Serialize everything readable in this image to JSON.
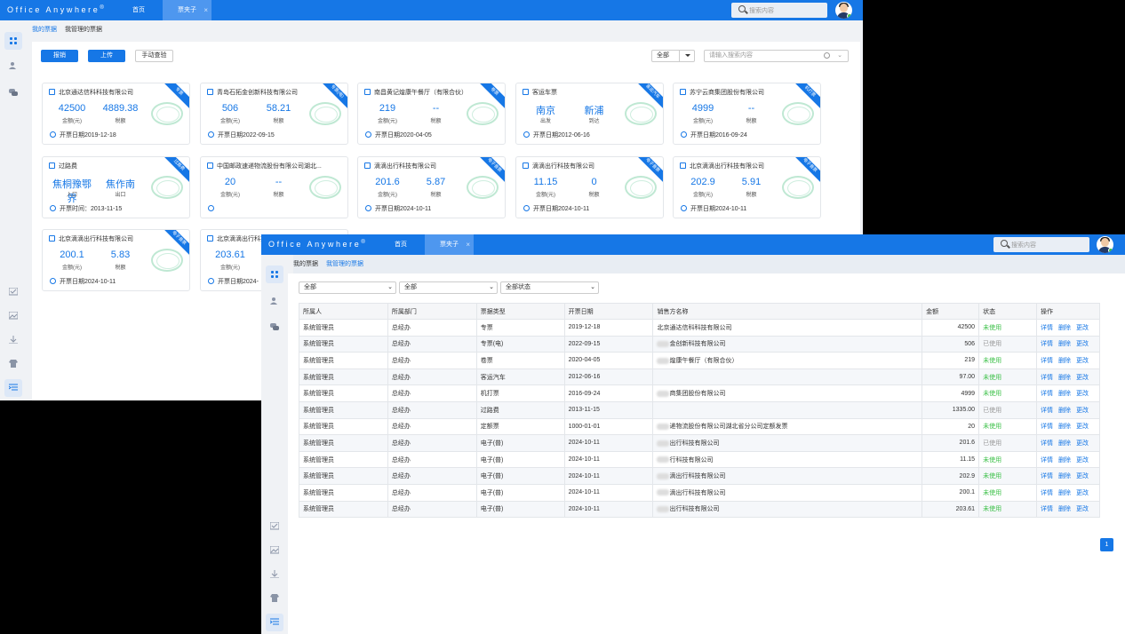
{
  "app": {
    "logo": "Office Anywhere",
    "reg": "®",
    "home_tab": "首页",
    "active_tab": "票夹子",
    "tab_close": "×",
    "search_placeholder": "搜索内容"
  },
  "w1": {
    "subnav": [
      "我的票据",
      "我管理的票据"
    ],
    "buttons": {
      "reimburse": "报销",
      "upload": "上传",
      "manual": "手动查验"
    },
    "filter": "全部",
    "search_placeholder": "请输入搜索内容",
    "cards": [
      {
        "name": "北京通达信科科技有限公司",
        "tag": "专票",
        "v1": "42500",
        "l1": "金额(元)",
        "v2": "4889.38",
        "l2": "税额",
        "date": "开票日期2019-12-18"
      },
      {
        "name": "青岛石拓金创新科技有限公司",
        "tag": "专票(电)",
        "v1": "506",
        "l1": "金额(元)",
        "v2": "58.21",
        "l2": "税额",
        "date": "开票日期2022-09-15"
      },
      {
        "name": "南昌黄记煌康午餐厅（有限合伙）",
        "tag": "卷票",
        "v1": "219",
        "l1": "金额(元)",
        "v2": "--",
        "l2": "税额",
        "date": "开票日期2020-04-05"
      },
      {
        "name": "客运车票",
        "tag": "客运汽车",
        "v1": "南京",
        "l1": "出发",
        "v2": "新浦",
        "l2": "到达",
        "date": "开票日期2012-06-16"
      },
      {
        "name": "苏宁云商集团股份有限公司",
        "tag": "机打票",
        "v1": "4999",
        "l1": "金额(元)",
        "v2": "--",
        "l2": "税额",
        "date": "开票日期2016-09-24"
      },
      {
        "name": "过路费",
        "tag": "过路费",
        "v1": "焦桐豫鄂界",
        "l1": "入口",
        "v2": "焦作南",
        "l2": "出口",
        "date": "开票时间：2013-11-15"
      },
      {
        "name": "中国邮政速递物流股份有限公司湖北...",
        "tag": "",
        "v1": "20",
        "l1": "金额(元)",
        "v2": "--",
        "l2": "税额",
        "date": ""
      },
      {
        "name": "滴滴出行科技有限公司",
        "tag": "电子普票",
        "v1": "201.6",
        "l1": "金额(元)",
        "v2": "5.87",
        "l2": "税额",
        "date": "开票日期2024-10-11"
      },
      {
        "name": "滴滴出行科技有限公司",
        "tag": "电子普票",
        "v1": "11.15",
        "l1": "金额(元)",
        "v2": "0",
        "l2": "税额",
        "date": "开票日期2024-10-11"
      },
      {
        "name": "北京滴滴出行科技有限公司",
        "tag": "电子普票",
        "v1": "202.9",
        "l1": "金额(元)",
        "v2": "5.91",
        "l2": "税额",
        "date": "开票日期2024-10-11"
      },
      {
        "name": "北京滴滴出行科技有限公司",
        "tag": "电子普票",
        "v1": "200.1",
        "l1": "金额(元)",
        "v2": "5.83",
        "l2": "税额",
        "date": "开票日期2024-10-11"
      },
      {
        "name": "北京滴滴出行科技有限公司",
        "tag": "",
        "v1": "203.61",
        "l1": "金额(元)",
        "v2": "",
        "l2": "",
        "date": "开票日期2024-"
      }
    ]
  },
  "w2": {
    "subnav": [
      "我的票据",
      "我管理的票据"
    ],
    "filters": [
      "全部",
      "全部",
      "全部状态"
    ],
    "table": {
      "headers": [
        "所属人",
        "所属部门",
        "票据类型",
        "开票日期",
        "销售方名称",
        "金额",
        "状态",
        "操作"
      ],
      "ops": [
        "详情",
        "删除",
        "更改"
      ],
      "rows": [
        [
          "系统管理员",
          "总经办",
          "专票",
          "2019-12-18",
          "北京通达信科科技有限公司",
          "42500",
          "未使用"
        ],
        [
          "系统管理员",
          "总经办",
          "专票(电)",
          "2022-09-15",
          "金创新科技有限公司",
          "506",
          "已使用"
        ],
        [
          "系统管理员",
          "总经办",
          "卷票",
          "2020-04-05",
          "煌康午餐厅（有限合伙）",
          "219",
          "未使用"
        ],
        [
          "系统管理员",
          "总经办",
          "客运汽车",
          "2012-06-16",
          "",
          "97.00",
          "未使用"
        ],
        [
          "系统管理员",
          "总经办",
          "机打票",
          "2016-09-24",
          "商集团股份有限公司",
          "4999",
          "未使用"
        ],
        [
          "系统管理员",
          "总经办",
          "过路费",
          "2013-11-15",
          "",
          "1335.00",
          "已使用"
        ],
        [
          "系统管理员",
          "总经办",
          "定额票",
          "1000-01-01",
          "递物流股份有限公司湖北省分公司定额发票",
          "20",
          "未使用"
        ],
        [
          "系统管理员",
          "总经办",
          "电子(普)",
          "2024-10-11",
          "出行科技有限公司",
          "201.6",
          "已使用"
        ],
        [
          "系统管理员",
          "总经办",
          "电子(普)",
          "2024-10-11",
          "行科技有限公司",
          "11.15",
          "未使用"
        ],
        [
          "系统管理员",
          "总经办",
          "电子(普)",
          "2024-10-11",
          "滴出行科技有限公司",
          "202.9",
          "未使用"
        ],
        [
          "系统管理员",
          "总经办",
          "电子(普)",
          "2024-10-11",
          "滴出行科技有限公司",
          "200.1",
          "未使用"
        ],
        [
          "系统管理员",
          "总经办",
          "电子(普)",
          "2024-10-11",
          "出行科技有限公司",
          "203.61",
          "未使用"
        ]
      ]
    },
    "page": "1"
  }
}
